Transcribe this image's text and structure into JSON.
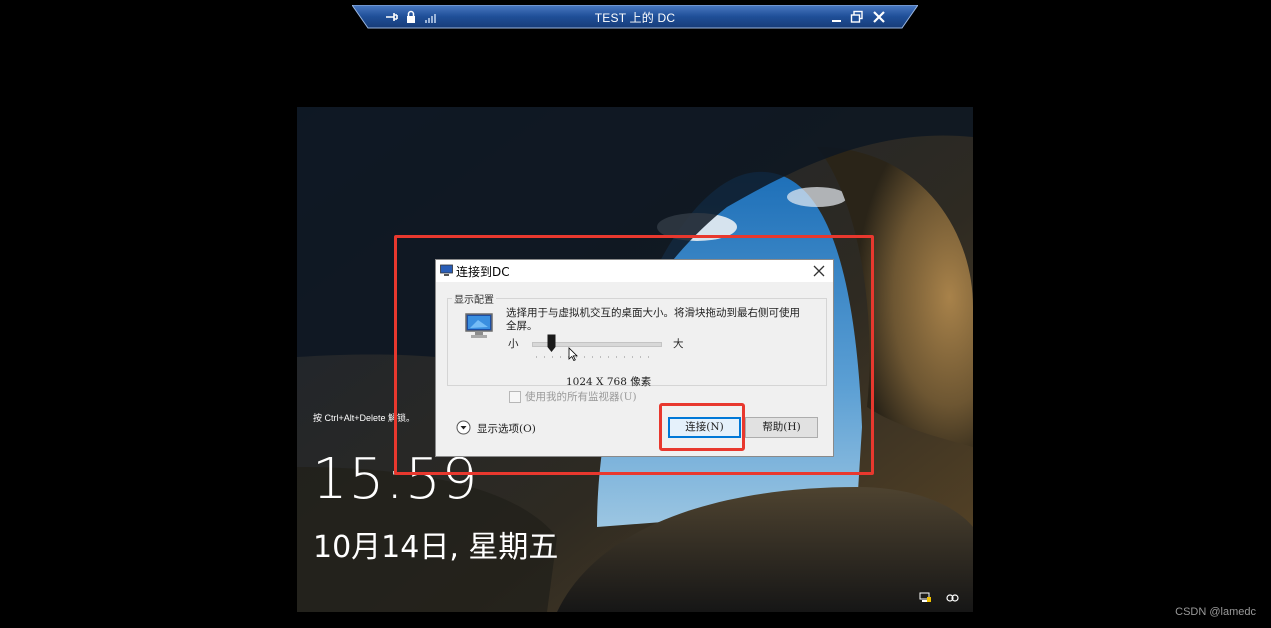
{
  "rdp_bar": {
    "title": "TEST 上的 DC",
    "icons_left": [
      "pin-icon",
      "lock-icon",
      "signal-strength-icon"
    ],
    "icons_right": [
      "minimize-icon",
      "restore-icon",
      "close-icon"
    ]
  },
  "lock_screen": {
    "unlock_hint": "按 Ctrl+Alt+Delete 解锁。",
    "time": "15:59",
    "date": "10月14日, 星期五",
    "tray_icons": [
      "network-icon",
      "accessibility-icon"
    ]
  },
  "dialog": {
    "title": "连接到DC",
    "group_label": "显示配置",
    "description": "选择用于与虚拟机交互的桌面大小。将滑块拖动到最右侧可使用全屏。",
    "slider_min_label": "小",
    "slider_max_label": "大",
    "slider_value_fraction": 0.15,
    "resolution_text": "1024 X 768 像素",
    "all_monitors_label": "使用我的所有监视器(U)",
    "all_monitors_checked": false,
    "options_label": "显示选项(O)",
    "connect_label": "连接(N)",
    "help_label": "帮助(H)"
  },
  "colors": {
    "highlight": "#e8382e",
    "rdp_bar": "#1d4a8f"
  },
  "watermark": "CSDN @lamedc"
}
